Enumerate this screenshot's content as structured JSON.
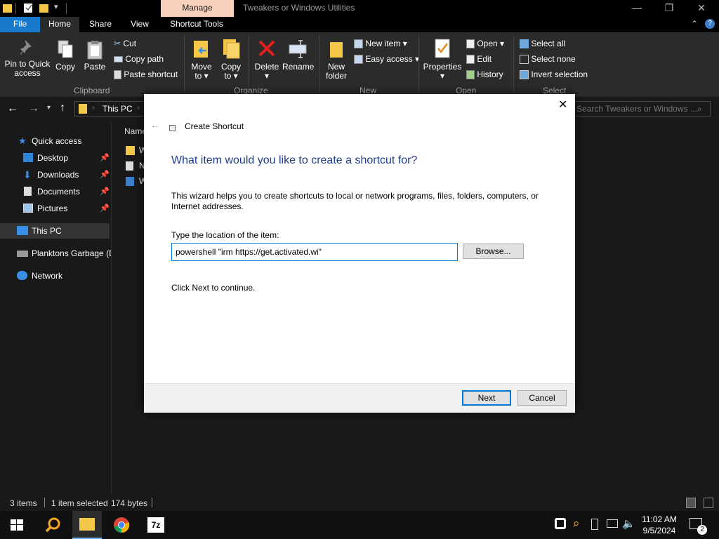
{
  "window": {
    "title": "Tweakers or Windows Utilities",
    "context_tab": "Manage",
    "minimize": "—",
    "maximize": "❐",
    "close": "✕"
  },
  "ribbon_tabs": [
    "File",
    "Home",
    "Share",
    "View",
    "Shortcut Tools"
  ],
  "clipboard": {
    "pin_line1": "Pin to Quick",
    "pin_line2": "access",
    "copy": "Copy",
    "paste": "Paste",
    "cut": "Cut",
    "copy_path": "Copy path",
    "paste_shortcut": "Paste shortcut",
    "group_label": "Clipboard"
  },
  "organize": {
    "move_line1": "Move",
    "move_line2": "to",
    "copy_line1": "Copy",
    "copy_line2": "to",
    "delete": "Delete",
    "rename": "Rename",
    "group_label": "Organize"
  },
  "new_group": {
    "new_folder_line1": "New",
    "new_folder_line2": "folder",
    "new_item": "New item",
    "easy_access": "Easy access",
    "group_label": "New"
  },
  "open_group": {
    "properties": "Properties",
    "open": "Open",
    "edit": "Edit",
    "history": "History",
    "group_label": "Open"
  },
  "select_group": {
    "select_all": "Select all",
    "select_none": "Select none",
    "invert_selection": "Invert selection",
    "group_label": "Select"
  },
  "address": {
    "path": "This PC",
    "search_placeholder": "Search Tweakers or Windows ..."
  },
  "nav_pane": {
    "quick_access": "Quick access",
    "desktop": "Desktop",
    "downloads": "Downloads",
    "documents": "Documents",
    "pictures": "Pictures",
    "this_pc": "This PC",
    "drive": "Planktons Garbage (D",
    "network": "Network"
  },
  "content": {
    "name_header": "Name",
    "row1": "W",
    "row2": "N",
    "row3": "W"
  },
  "status": {
    "items": "3 items",
    "selected": "1 item selected",
    "size": "174 bytes"
  },
  "dialog": {
    "title": "Create Shortcut",
    "heading": "What item would you like to create a shortcut for?",
    "description": "This wizard helps you to create shortcuts to local or network programs, files, folders, computers, or Internet addresses.",
    "field_label": "Type the location of the item:",
    "location_value": "powershell \"irm https://get.activated.wi\"",
    "browse": "Browse...",
    "continue_text": "Click Next to continue.",
    "next": "Next",
    "cancel": "Cancel"
  },
  "taskbar": {
    "time": "11:02 AM",
    "date": "9/5/2024",
    "notification_count": "2"
  },
  "colors": {
    "accent": "#0078d7",
    "file_tab": "#1979ca",
    "manage_tab": "#f8d1bc",
    "heading_blue": "#1e3d8a"
  }
}
